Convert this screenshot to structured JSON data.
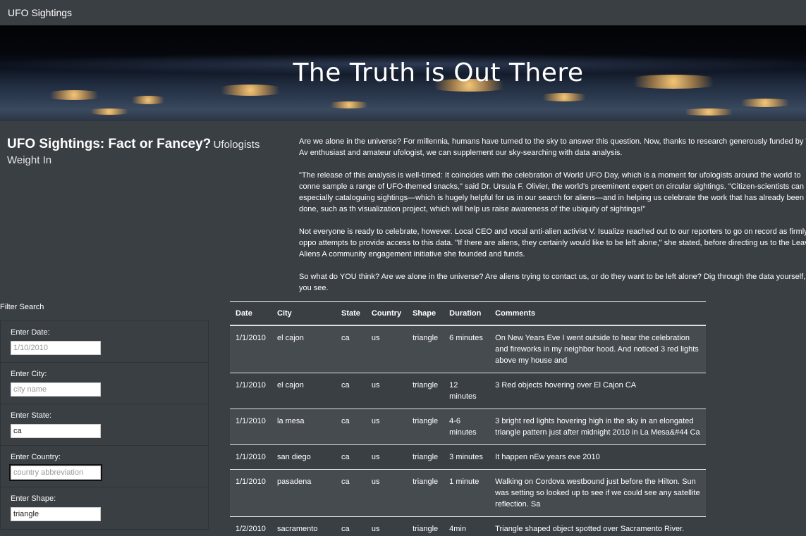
{
  "navbar": {
    "brand": "UFO Sightings"
  },
  "hero": {
    "title": "The Truth is Out There"
  },
  "heading": {
    "main": "UFO Sightings: Fact or Fancey?",
    "sub": "Ufologists Weight In"
  },
  "article": {
    "paragraphs": [
      "Are we alone in the universe? For millennia, humans have turned to the sky to answer this question. Now, thanks to research generously funded by W. Av enthusiast and amateur ufologist, we can supplement our sky-searching with data analysis.",
      "\"The release of this analysis is well-timed: It coincides with the celebration of World UFO Day, which is a moment for ufologists around the world to conne sample a range of UFO-themed snacks,\" said Dr. Ursula F. Olivier, the world's preeminent expert on circular sightings. \"Citizen-scientists can be especially cataloguing sightings—which is hugely helpful for us in our search for aliens—and in helping us celebrate the work that has already been done, such as th visualization project, which will help us raise awareness of the ubiquity of sightings!\"",
      "Not everyone is ready to celebrate, however. Local CEO and vocal anti-alien activist V. Isualize reached out to our reporters to go on record as firmly oppo attempts to provide access to this data. \"If there are aliens, they certainly would like to be left alone,\" she stated, before directing us to the Leave Aliens A community engagement initiative she founded and funds.",
      "So what do YOU think? Are we alone in the universe? Are aliens trying to contact us, or do they want to be left alone? Dig through the data yourself, and you see."
    ]
  },
  "filters": {
    "title": "Filter Search",
    "date": {
      "label": "Enter Date:",
      "placeholder": "1/10/2010",
      "value": ""
    },
    "city": {
      "label": "Enter City:",
      "placeholder": "city name",
      "value": ""
    },
    "state": {
      "label": "Enter State:",
      "placeholder": "",
      "value": "ca"
    },
    "country": {
      "label": "Enter Country:",
      "placeholder": "country abbreviation",
      "value": ""
    },
    "shape": {
      "label": "Enter Shape:",
      "placeholder": "",
      "value": "triangle"
    }
  },
  "table": {
    "headers": [
      "Date",
      "City",
      "State",
      "Country",
      "Shape",
      "Duration",
      "Comments"
    ],
    "rows": [
      [
        "1/1/2010",
        "el cajon",
        "ca",
        "us",
        "triangle",
        "6 minutes",
        "On New Years Eve I went outside to hear the celebration and fireworks in my neighbor hood. And noticed 3 red lights above my house and"
      ],
      [
        "1/1/2010",
        "el cajon",
        "ca",
        "us",
        "triangle",
        "12 minutes",
        "3 Red objects hovering over El Cajon CA"
      ],
      [
        "1/1/2010",
        "la mesa",
        "ca",
        "us",
        "triangle",
        "4-6 minutes",
        "3 bright red lights hovering high in the sky in an elongated triangle pattern just after midnight 2010 in La Mesa&#44 Ca"
      ],
      [
        "1/1/2010",
        "san diego",
        "ca",
        "us",
        "triangle",
        "3 minutes",
        "It happen nEw years eve 2010"
      ],
      [
        "1/1/2010",
        "pasadena",
        "ca",
        "us",
        "triangle",
        "1 minute",
        "Walking on Cordova westbound just before the Hilton. Sun was setting so looked up to see if we could see any satellite reflection. Sa"
      ],
      [
        "1/2/2010",
        "sacramento",
        "ca",
        "us",
        "triangle",
        "4min",
        "Triangle shaped object spotted over Sacramento River."
      ]
    ]
  }
}
